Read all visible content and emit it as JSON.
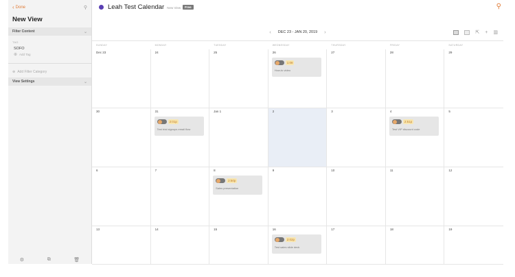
{
  "sidebar": {
    "done_label": "Done",
    "title": "New View",
    "filter_content_label": "Filter Content",
    "tag_label": "TAG",
    "tag_value": "SOFO",
    "add_tag_label": "Add Tag",
    "add_filter_category_label": "Add Filter Category",
    "view_settings_label": "View Settings"
  },
  "header": {
    "calendar_title": "Leah Test Calendar",
    "view_sub": "New View",
    "badge": "Free"
  },
  "toolbar": {
    "date_range": "DEC 23 - JAN 20, 2019"
  },
  "days_of_week": [
    "SUNDAY",
    "MONDAY",
    "TUESDAY",
    "WEDNESDAY",
    "THURSDAY",
    "FRIDAY",
    "SATURDAY"
  ],
  "weeks": [
    [
      "Dec 23",
      "24",
      "25",
      "26",
      "27",
      "28",
      "29"
    ],
    [
      "30",
      "31",
      "Jan 1",
      "2",
      "3",
      "4",
      "5"
    ],
    [
      "6",
      "7",
      "8",
      "9",
      "10",
      "11",
      "12"
    ],
    [
      "13",
      "14",
      "15",
      "16",
      "17",
      "18",
      "19"
    ]
  ],
  "events": [
    {
      "time": "1:08",
      "name": "How-to video"
    },
    {
      "time": "2:01p",
      "name": "Test trial signups email flow"
    },
    {
      "time": "2:51p",
      "name": "Test VIP discount code"
    },
    {
      "time": "2:50p",
      "name": "Sales presentation"
    },
    {
      "time": "2:02p",
      "name": "Test sales slide deck"
    }
  ],
  "colors": {
    "accent": "#e07b36",
    "calendar_dot": "#5a3fb3",
    "highlight_cell": "#e9eef6"
  }
}
